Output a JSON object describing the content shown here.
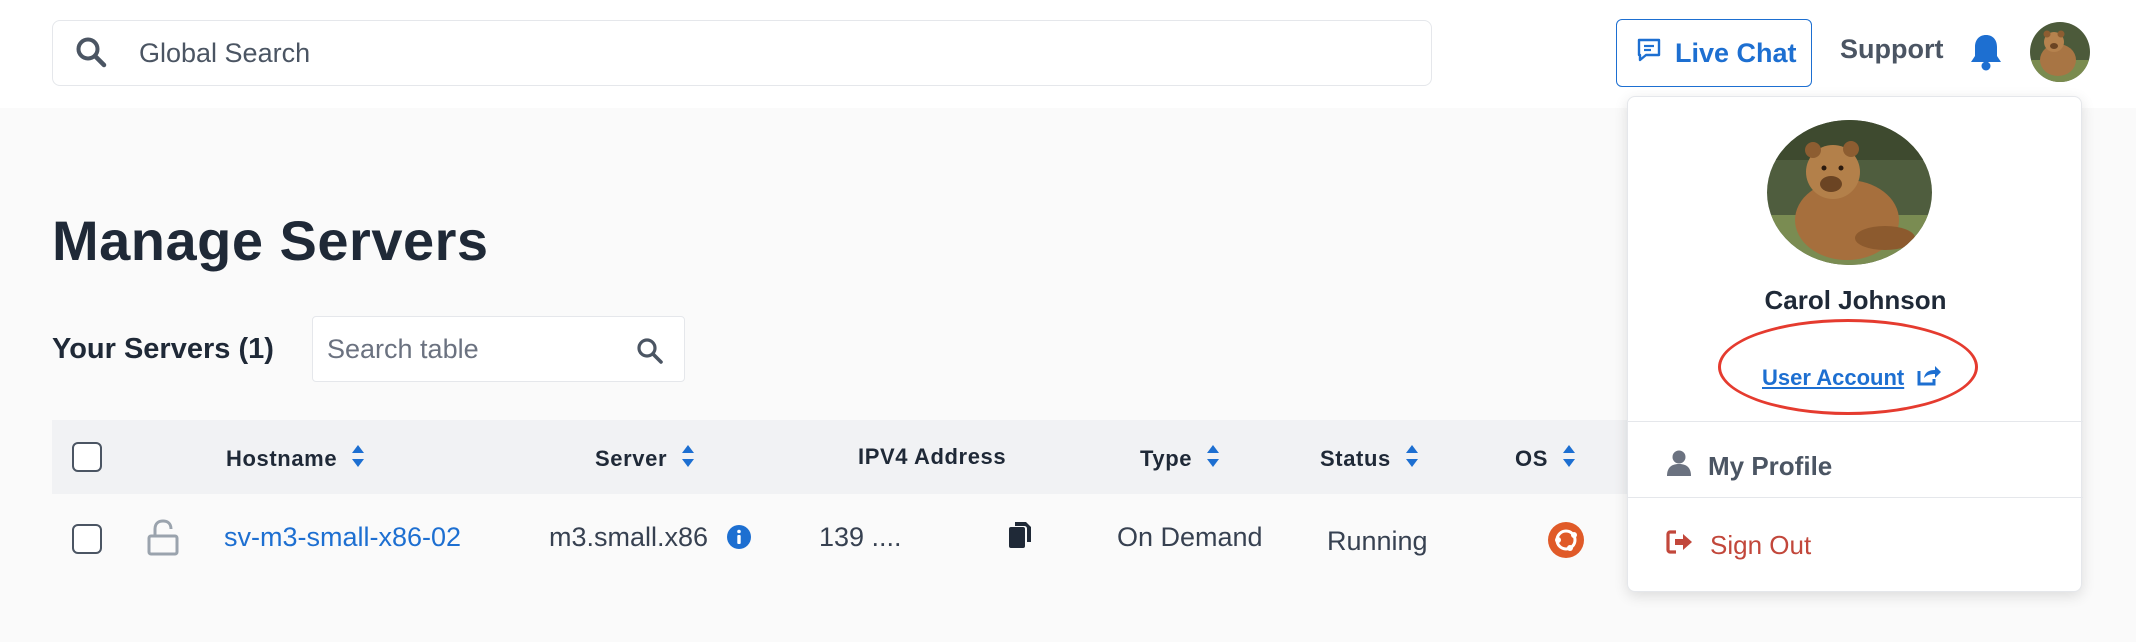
{
  "header": {
    "search_placeholder": "Global Search",
    "live_chat_label": "Live Chat",
    "support_label": "Support"
  },
  "page": {
    "title": "Manage Servers",
    "servers_label": "Your Servers (1)",
    "table_search_placeholder": "Search table"
  },
  "table": {
    "columns": [
      "Hostname",
      "Server",
      "IPV4 Address",
      "Type",
      "Status",
      "OS"
    ],
    "rows": [
      {
        "hostname": "sv-m3-small-x86-02",
        "server": "m3.small.x86",
        "ipv4": "139 ....",
        "type": "On Demand",
        "status": "Running",
        "os_icon": "ubuntu-icon"
      }
    ]
  },
  "user_menu": {
    "name": "Carol Johnson",
    "user_account_label": "User Account",
    "my_profile_label": "My Profile",
    "sign_out_label": "Sign Out"
  },
  "colors": {
    "accent": "#1d6fd1",
    "danger": "#c2473b",
    "highlight": "#e53b2f",
    "ubuntu": "#e05a28"
  }
}
